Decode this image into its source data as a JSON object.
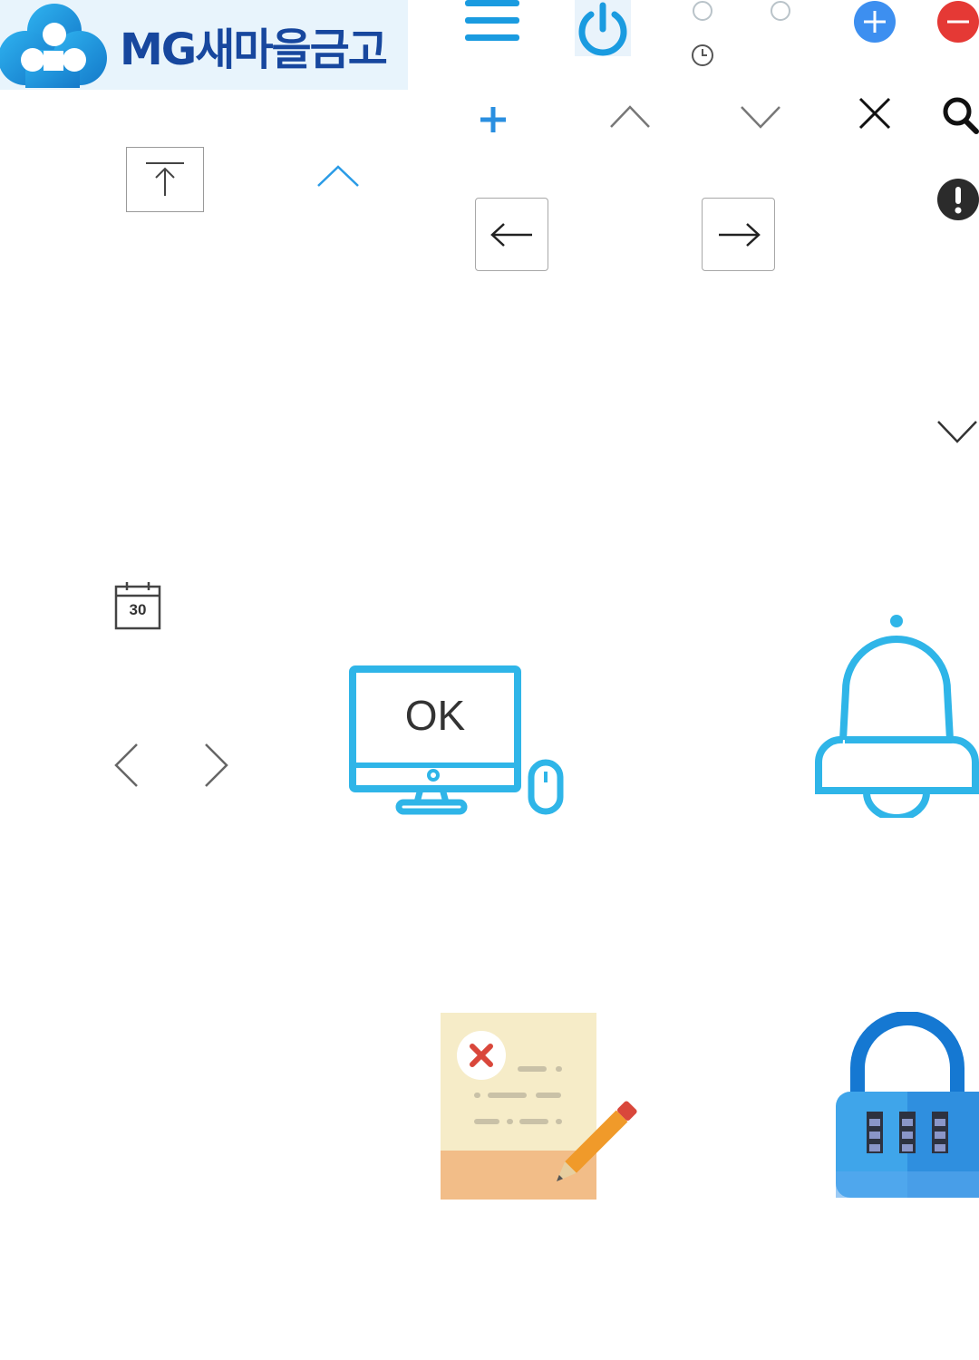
{
  "brand": {
    "name": "MG새마을금고",
    "logo_icon": "clover-cloud-logo",
    "colors": {
      "primary_blue": "#1a9be0",
      "logo_text": "#17479e",
      "logo_bg": "#e8f4fc",
      "danger": "#e53935",
      "accent_cyan": "#29b6e8"
    }
  },
  "icons": {
    "menu": "hamburger-menu-icon",
    "power": "power-icon",
    "radio_a": "radio-empty-icon",
    "radio_b": "radio-empty-icon",
    "clock": "clock-icon",
    "add_circle": "plus-circle-icon",
    "remove_circle": "minus-circle-icon",
    "plus": "plus-icon",
    "chevron_up": "chevron-up-icon",
    "chevron_down": "chevron-down-icon",
    "close": "close-icon",
    "search": "search-icon",
    "scroll_top": "scroll-to-top-icon",
    "chevron_up_blue": "chevron-up-blue-icon",
    "arrow_left": "arrow-left-icon",
    "arrow_right": "arrow-right-icon",
    "alert": "alert-circle-icon",
    "chevron_down_large": "chevron-down-large-icon",
    "calendar": "calendar-icon",
    "chevron_prev": "chevron-left-icon",
    "chevron_next": "chevron-right-icon",
    "computer": "computer-monitor-icon",
    "bell": "bell-icon",
    "document_edit": "document-edit-error-icon",
    "combination_lock": "combination-lock-icon"
  },
  "calendar": {
    "day": "30"
  },
  "monitor": {
    "screen_text": "OK"
  }
}
